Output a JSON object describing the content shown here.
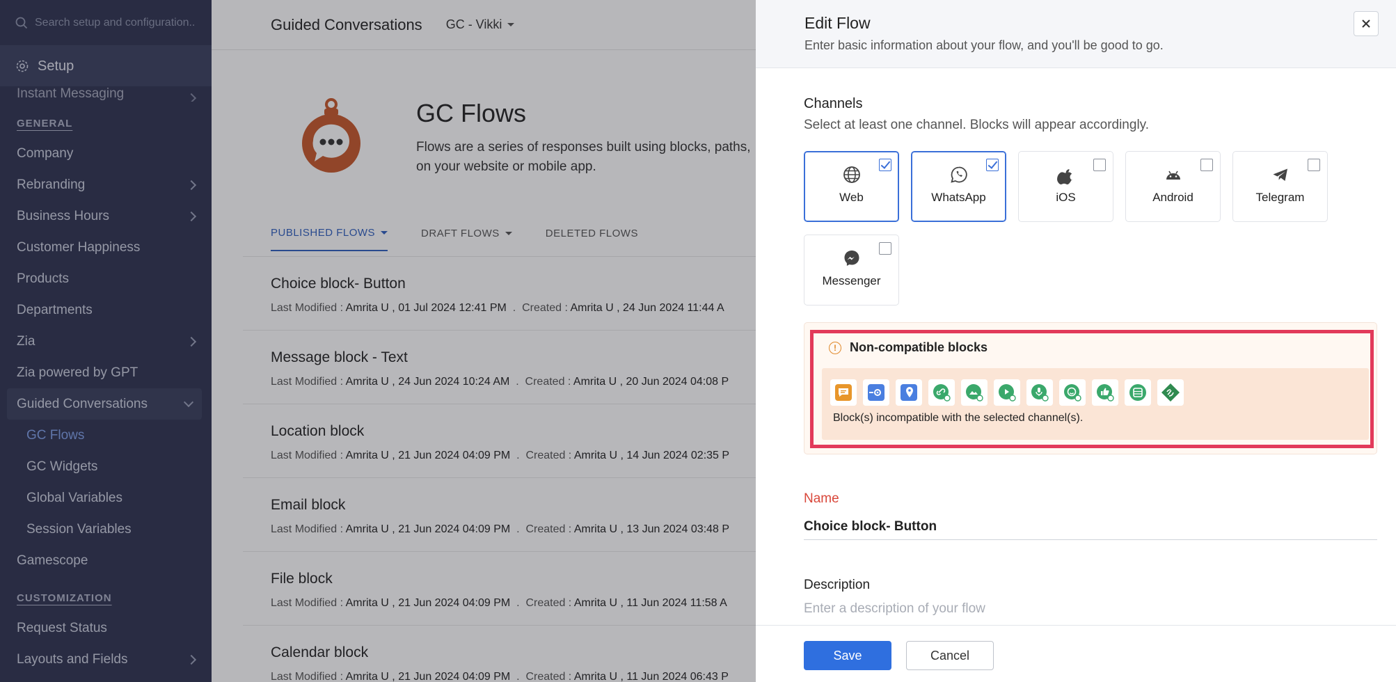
{
  "sidebar": {
    "search_placeholder": "Search setup and configuration..",
    "setup_label": "Setup",
    "cut_item": "Instant Messaging",
    "general_label": "GENERAL",
    "general_items": [
      "Company",
      "Rebranding",
      "Business Hours",
      "Customer Happiness",
      "Products",
      "Departments",
      "Zia",
      "Zia powered by GPT",
      "Guided Conversations"
    ],
    "gc_sub": [
      "GC Flows",
      "GC Widgets",
      "Global Variables",
      "Session Variables"
    ],
    "after_items": [
      "Gamescope"
    ],
    "customization_label": "CUSTOMIZATION",
    "customization_items": [
      "Request Status",
      "Layouts and Fields"
    ]
  },
  "main": {
    "title": "Guided Conversations",
    "selector": "GC - Vikki",
    "hero_title": "GC Flows",
    "hero_desc_1": "Flows are a series of responses built using blocks, paths,",
    "hero_desc_2": "on your website or mobile app.",
    "tabs": [
      "PUBLISHED FLOWS",
      "DRAFT FLOWS",
      "DELETED FLOWS"
    ],
    "meta_lm": "Last Modified :",
    "meta_cr": "Created :",
    "flows": [
      {
        "name": "Choice block- Button",
        "modified": "Amrita U , 01 Jul 2024 12:41 PM",
        "created": "Amrita U , 24 Jun 2024 11:44 A"
      },
      {
        "name": "Message block - Text",
        "modified": "Amrita U , 24 Jun 2024 10:24 AM",
        "created": "Amrita U , 20 Jun 2024 04:08 P"
      },
      {
        "name": "Location block",
        "modified": "Amrita U , 21 Jun 2024 04:09 PM",
        "created": "Amrita U , 14 Jun 2024 02:35 P"
      },
      {
        "name": "Email block",
        "modified": "Amrita U , 21 Jun 2024 04:09 PM",
        "created": "Amrita U , 13 Jun 2024 03:48 P"
      },
      {
        "name": "File block",
        "modified": "Amrita U , 21 Jun 2024 04:09 PM",
        "created": "Amrita U , 11 Jun 2024 11:58 A"
      },
      {
        "name": "Calendar block",
        "modified": "Amrita U , 21 Jun 2024 04:09 PM",
        "created": "Amrita U , 11 Jun 2024 06:43 P"
      }
    ]
  },
  "panel": {
    "title": "Edit Flow",
    "subtitle": "Enter basic information about your flow, and you'll be good to go.",
    "channels_title": "Channels",
    "channels_sub": "Select at least one channel. Blocks will appear accordingly.",
    "channels": [
      {
        "label": "Web",
        "icon": "globe-icon",
        "checked": true
      },
      {
        "label": "WhatsApp",
        "icon": "whatsapp-icon",
        "checked": true
      },
      {
        "label": "iOS",
        "icon": "apple-icon",
        "checked": false
      },
      {
        "label": "Android",
        "icon": "android-icon",
        "checked": false
      },
      {
        "label": "Telegram",
        "icon": "telegram-icon",
        "checked": false
      },
      {
        "label": "Messenger",
        "icon": "messenger-icon",
        "checked": false
      }
    ],
    "nc_title": "Non-compatible blocks",
    "nc_message": "Block(s) incompatible with the selected channel(s).",
    "nc_blocks": [
      {
        "icon": "chat-bubble-icon",
        "color": "#e8962b"
      },
      {
        "icon": "carousel-icon",
        "color": "#4a7fe0"
      },
      {
        "icon": "location-pin-icon",
        "color": "#4a7fe0"
      },
      {
        "icon": "link-icon",
        "color": "#3aa86b"
      },
      {
        "icon": "image-icon",
        "color": "#3aa86b"
      },
      {
        "icon": "video-icon",
        "color": "#3aa86b"
      },
      {
        "icon": "audio-icon",
        "color": "#3aa86b"
      },
      {
        "icon": "emoji-icon",
        "color": "#3aa86b"
      },
      {
        "icon": "thumbs-up-icon",
        "color": "#3aa86b"
      },
      {
        "icon": "grid-icon",
        "color": "#3aa86b"
      },
      {
        "icon": "webhook-icon",
        "color": "#2f8a4f"
      }
    ],
    "name_label": "Name",
    "name_value": "Choice block- Button",
    "desc_label": "Description",
    "desc_placeholder": "Enter a description of your flow",
    "save_label": "Save",
    "cancel_label": "Cancel"
  },
  "colors": {
    "accent": "#2f6fdf",
    "sidebar_bg": "#2e3350",
    "highlight_border": "#e23a5a",
    "brand_orange": "#c7582a"
  }
}
